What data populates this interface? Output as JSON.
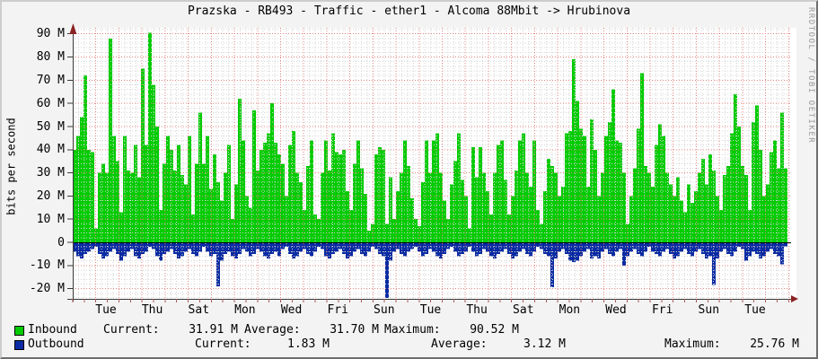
{
  "watermark": "RRDTOOL / TOBI OETIKER",
  "colors": {
    "background": "#F3F3F3",
    "plot_background": "#FFFFFF",
    "inbound": "#00CC00",
    "outbound": "#0A2BA3",
    "grid_major": "#E58383",
    "grid_minor": "#D4D4D4",
    "axis": "#3A3A3A",
    "axis_arrow": "#8B2323",
    "zero_line": "#000000",
    "watermark_gray": "#9A9A9A"
  },
  "chart_data": {
    "type": "bar",
    "title": "Prazska - RB493 - Traffic - ether1 - Alcoma 88Mbit -> Hrubinova",
    "ylabel": "bits per second",
    "unit": "M (megabits per second)",
    "ylim": [
      -24.5,
      93
    ],
    "grid": "dotted, red majors every 10M and every day, gray minors",
    "legend_position": "bottom-left",
    "yticks": [
      {
        "value": 90,
        "label": "90 M"
      },
      {
        "value": 80,
        "label": "80 M"
      },
      {
        "value": 70,
        "label": "70 M"
      },
      {
        "value": 60,
        "label": "60 M"
      },
      {
        "value": 50,
        "label": "50 M"
      },
      {
        "value": 40,
        "label": "40 M"
      },
      {
        "value": 30,
        "label": "30 M"
      },
      {
        "value": 20,
        "label": "20 M"
      },
      {
        "value": 10,
        "label": "10 M"
      },
      {
        "value": 0,
        "label": "0"
      },
      {
        "value": -10,
        "label": "-10 M"
      },
      {
        "value": -20,
        "label": "-20 M"
      }
    ],
    "xlabels": [
      "Tue",
      "Thu",
      "Sat",
      "Mon",
      "Wed",
      "Fri",
      "Sun",
      "Tue",
      "Thu",
      "Sat",
      "Mon",
      "Wed",
      "Fri",
      "Sun",
      "Tue"
    ],
    "series": [
      {
        "name": "Inbound",
        "color": "#00CC00",
        "values": [
          40,
          46,
          54,
          72,
          40,
          39,
          6,
          30,
          34,
          30,
          88,
          46,
          35,
          13,
          46,
          31,
          30,
          42,
          28,
          75,
          42,
          90.5,
          68,
          50,
          14,
          34,
          46,
          40,
          31,
          42,
          29,
          25,
          46,
          12,
          34,
          56,
          34,
          46,
          23,
          38,
          26,
          18,
          30,
          42,
          10,
          25,
          62,
          44,
          20,
          15,
          57,
          31,
          40,
          43,
          47,
          60,
          43,
          38,
          34,
          20,
          42,
          48,
          30,
          26,
          14,
          33,
          44,
          12,
          10,
          30,
          44,
          31,
          47,
          39,
          38,
          40,
          22,
          14,
          34,
          44,
          32,
          21,
          5,
          8,
          38,
          41,
          40,
          8,
          28,
          10,
          22,
          30,
          44,
          33,
          19,
          10,
          7,
          26,
          44,
          30,
          44,
          47,
          30,
          18,
          10,
          25,
          35,
          47,
          27,
          20,
          6,
          41,
          28,
          41,
          30,
          22,
          12,
          30,
          42,
          44,
          27,
          12,
          20,
          31,
          44,
          47,
          30,
          24,
          44,
          14,
          8,
          22,
          36,
          33,
          30,
          20,
          24,
          47,
          48,
          79,
          61,
          49,
          46,
          24,
          53,
          40,
          20,
          30,
          46,
          52,
          66,
          44,
          43,
          30,
          8,
          20,
          32,
          49,
          73,
          33,
          30,
          24,
          42,
          51,
          46,
          30,
          25,
          20,
          28,
          18,
          13,
          25,
          17,
          22,
          30,
          36,
          25,
          38,
          31,
          20,
          14,
          29,
          33,
          47,
          64,
          50,
          33,
          29,
          14,
          52,
          59,
          40,
          20,
          25,
          39,
          44,
          32,
          56,
          32
        ]
      },
      {
        "name": "Outbound",
        "color": "#0A2BA3",
        "values": [
          -4,
          -6,
          -7,
          -5,
          -4,
          -3,
          -2,
          -5,
          -7,
          -6,
          -4,
          -3,
          -5,
          -8,
          -6,
          -4,
          -3,
          -6,
          -7,
          -5,
          -4,
          -2,
          -3,
          -6,
          -8,
          -5,
          -4,
          -3,
          -5,
          -7,
          -6,
          -4,
          -3,
          -5,
          -6,
          -4,
          -2,
          -4,
          -6,
          -5,
          -19,
          -8,
          -5,
          -4,
          -6,
          -7,
          -5,
          -3,
          -4,
          -6,
          -5,
          -3,
          -4,
          -6,
          -7,
          -5,
          -4,
          -6,
          -3,
          -2,
          -5,
          -7,
          -6,
          -4,
          -3,
          -5,
          -6,
          -4,
          -2,
          -3,
          -6,
          -7,
          -5,
          -4,
          -3,
          -5,
          -7,
          -6,
          -4,
          -3,
          -5,
          -6,
          -4,
          -2,
          -3,
          -5,
          -6,
          -24.4,
          -8,
          -4,
          -3,
          -5,
          -6,
          -4,
          -3,
          -2,
          -4,
          -6,
          -5,
          -3,
          -4,
          -6,
          -7,
          -5,
          -3,
          -2,
          -4,
          -6,
          -5,
          -4,
          -2,
          -4,
          -6,
          -5,
          -3,
          -4,
          -6,
          -7,
          -5,
          -4,
          -3,
          -5,
          -7,
          -6,
          -4,
          -3,
          -5,
          -6,
          -4,
          -2,
          -3,
          -5,
          -6,
          -19.4,
          -7,
          -4,
          -3,
          -5,
          -8,
          -8.5,
          -8,
          -6,
          -4,
          -3,
          -7,
          -6,
          -7,
          -4,
          -3,
          -5,
          -6,
          -4,
          -3,
          -10,
          -6,
          -4,
          -3,
          -5,
          -6,
          -4,
          -2,
          -4,
          -5,
          -6,
          -4,
          -3,
          -5,
          -7,
          -6,
          -4,
          -3,
          -5,
          -6,
          -4,
          -3,
          -5,
          -7,
          -6,
          -18.5,
          -7,
          -4,
          -3,
          -5,
          -6,
          -4,
          -2,
          -3,
          -8,
          -6,
          -4,
          -5,
          -7,
          -6,
          -4,
          -3,
          -5,
          -6,
          -9.5,
          -1.8
        ]
      }
    ]
  },
  "legend": {
    "rows": [
      {
        "name": "Inbound",
        "swatch_color": "#00CC00",
        "stats": [
          {
            "label": "Current:",
            "value": "31.91 M"
          },
          {
            "label": "Average:",
            "value": "31.70 M"
          },
          {
            "label": "Maximum:",
            "value": "90.52 M"
          }
        ]
      },
      {
        "name": "Outbound",
        "swatch_color": "#0A2BA3",
        "stats": [
          {
            "label": "Current:",
            "value": "1.83 M"
          },
          {
            "label": "Average:",
            "value": "3.12 M"
          },
          {
            "label": "Maximum:",
            "value": "25.76 M"
          }
        ]
      }
    ]
  }
}
